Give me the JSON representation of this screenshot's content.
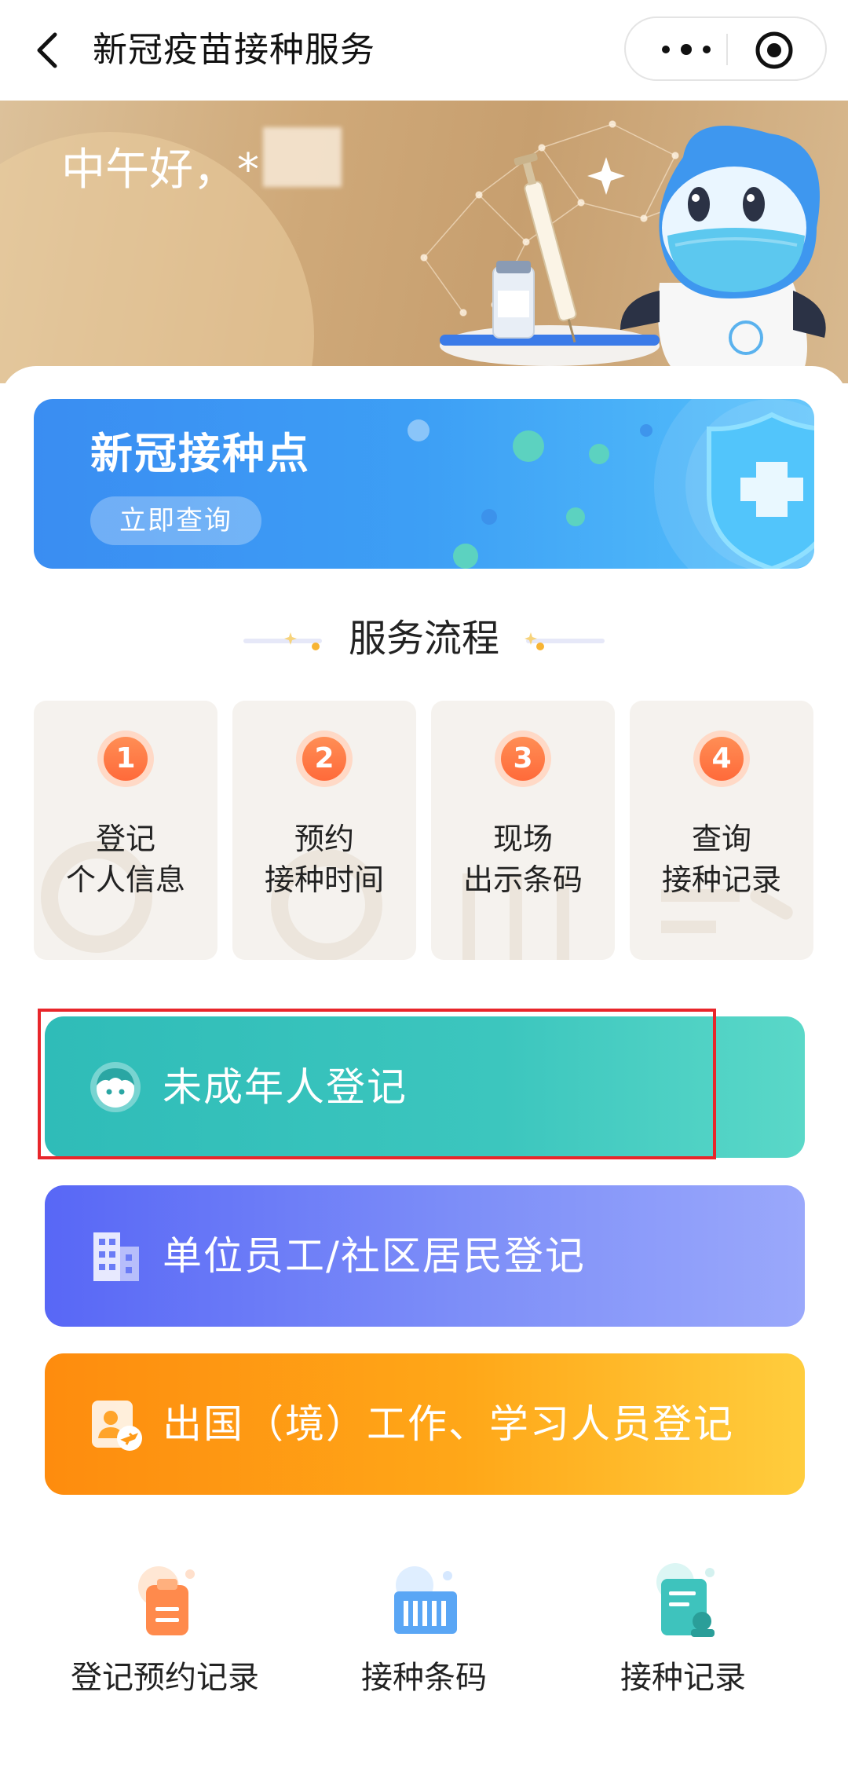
{
  "nav": {
    "title": "新冠疫苗接种服务"
  },
  "hero": {
    "greeting": "中午好，*"
  },
  "site_banner": {
    "title": "新冠接种点",
    "button": "立即查询"
  },
  "process": {
    "heading": "服务流程",
    "steps": [
      {
        "num": "1",
        "line1": "登记",
        "line2": "个人信息"
      },
      {
        "num": "2",
        "line1": "预约",
        "line2": "接种时间"
      },
      {
        "num": "3",
        "line1": "现场",
        "line2": "出示条码"
      },
      {
        "num": "4",
        "line1": "查询",
        "line2": "接种记录"
      }
    ]
  },
  "registration": {
    "minor": "未成年人登记",
    "unit": "单位员工/社区居民登记",
    "abroad": "出国（境）工作、学习人员登记"
  },
  "shortcuts": [
    {
      "label": "登记预约记录",
      "icon": "clipboard-icon"
    },
    {
      "label": "接种条码",
      "icon": "barcode-icon"
    },
    {
      "label": "接种记录",
      "icon": "record-icon"
    }
  ],
  "colors": {
    "minor": "#2fbcb8",
    "unit": "#5867f6",
    "abroad": "#fe8c0e",
    "step_badge": "#ff6a3a",
    "highlight": "#e8262b"
  }
}
